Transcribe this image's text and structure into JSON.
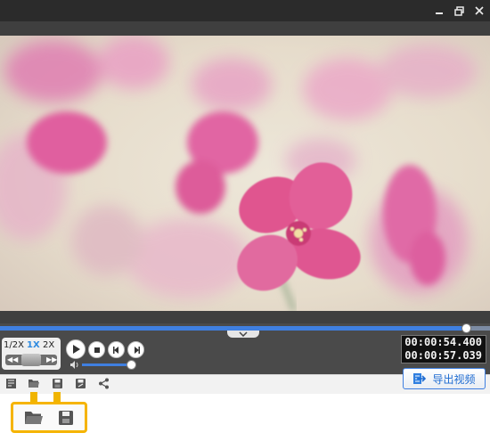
{
  "window": {
    "minimize_icon": "minimize-icon",
    "maximize_icon": "restore-icon",
    "close_icon": "close-icon"
  },
  "video": {
    "progress_fraction": 0.95
  },
  "speed": {
    "half_label": "1/2X",
    "normal_label": "1X",
    "double_label": "2X",
    "active": "1X"
  },
  "playback": {
    "buttons": [
      "play-icon",
      "stop-icon",
      "previous-frame-icon",
      "next-frame-icon"
    ]
  },
  "volume": {
    "level_fraction": 0.95
  },
  "time": {
    "current": "00:00:54.400",
    "total": "00:00:57.039"
  },
  "toolbar": {
    "icons": [
      "edit-icon",
      "open-folder-icon",
      "save-icon",
      "save-as-icon",
      "share-icon"
    ],
    "export_label": "导出视频"
  },
  "zoom_callout": {
    "icons": [
      "open-folder-icon",
      "save-icon"
    ]
  },
  "colors": {
    "accent": "#3f7fe0",
    "highlight": "#f5b400"
  }
}
